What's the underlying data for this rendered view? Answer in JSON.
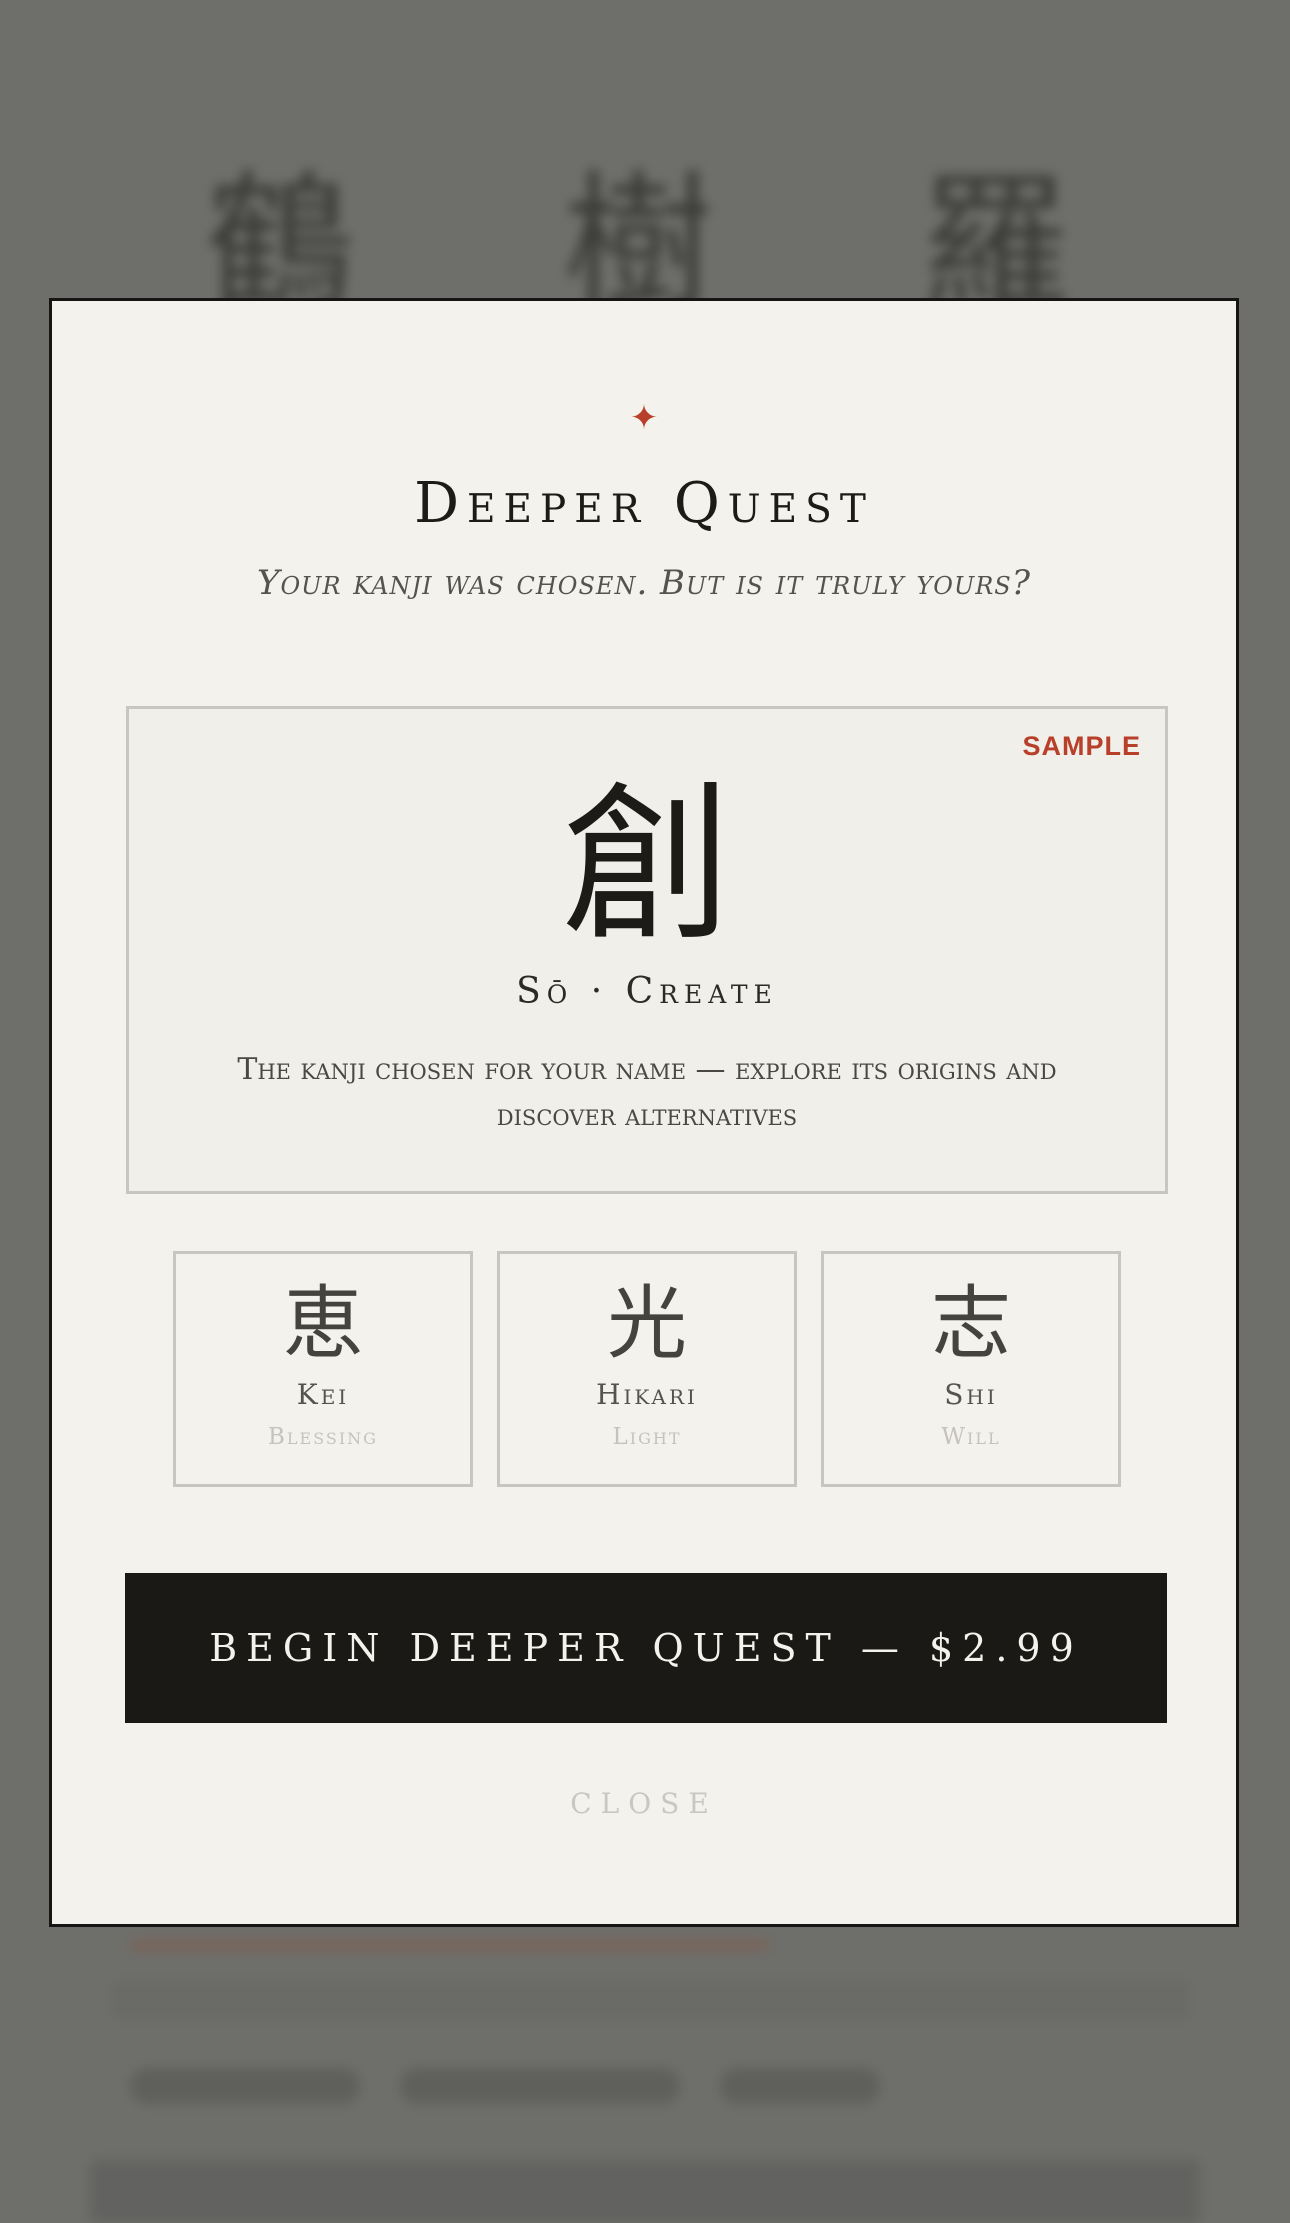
{
  "background": {
    "kanji": [
      "鶴",
      "樹",
      "羅"
    ]
  },
  "modal": {
    "ornament": "✦",
    "title": "Deeper Quest",
    "subtitle": "Your kanji was chosen. But is it truly yours?",
    "sample_card": {
      "badge": "SAMPLE",
      "kanji": "創",
      "reading": "Sō · Create",
      "description": "The kanji chosen for your name — explore its origins and discover alternatives"
    },
    "alternatives": [
      {
        "kanji": "恵",
        "reading": "Kei",
        "meaning": "Blessing"
      },
      {
        "kanji": "光",
        "reading": "Hikari",
        "meaning": "Light"
      },
      {
        "kanji": "志",
        "reading": "Shi",
        "meaning": "Will"
      }
    ],
    "cta_label": "BEGIN DEEPER QUEST — $2.99",
    "close_label": "CLOSE"
  },
  "colors": {
    "accent": "#b8402a",
    "overlay": "#6f6f6b",
    "modal_bg": "#f3f2ec",
    "button_bg": "#1b1915"
  }
}
